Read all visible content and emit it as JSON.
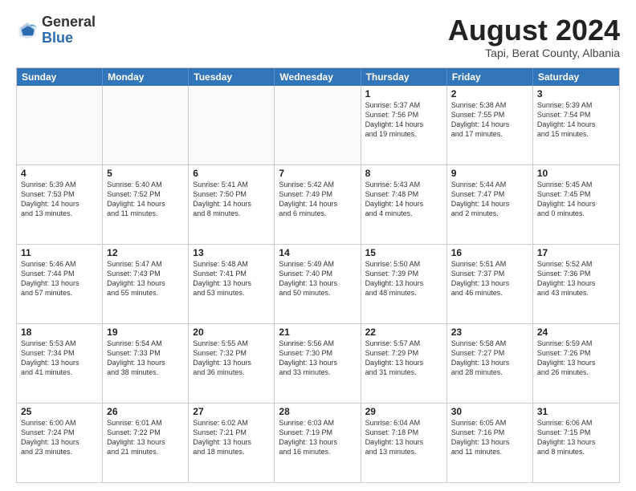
{
  "header": {
    "logo_general": "General",
    "logo_blue": "Blue",
    "month_title": "August 2024",
    "subtitle": "Tapi, Berat County, Albania"
  },
  "days_of_week": [
    "Sunday",
    "Monday",
    "Tuesday",
    "Wednesday",
    "Thursday",
    "Friday",
    "Saturday"
  ],
  "weeks": [
    [
      {
        "day": "",
        "lines": [],
        "empty": true
      },
      {
        "day": "",
        "lines": [],
        "empty": true
      },
      {
        "day": "",
        "lines": [],
        "empty": true
      },
      {
        "day": "",
        "lines": [],
        "empty": true
      },
      {
        "day": "1",
        "lines": [
          "Sunrise: 5:37 AM",
          "Sunset: 7:56 PM",
          "Daylight: 14 hours",
          "and 19 minutes."
        ],
        "empty": false
      },
      {
        "day": "2",
        "lines": [
          "Sunrise: 5:38 AM",
          "Sunset: 7:55 PM",
          "Daylight: 14 hours",
          "and 17 minutes."
        ],
        "empty": false
      },
      {
        "day": "3",
        "lines": [
          "Sunrise: 5:39 AM",
          "Sunset: 7:54 PM",
          "Daylight: 14 hours",
          "and 15 minutes."
        ],
        "empty": false
      }
    ],
    [
      {
        "day": "4",
        "lines": [
          "Sunrise: 5:39 AM",
          "Sunset: 7:53 PM",
          "Daylight: 14 hours",
          "and 13 minutes."
        ],
        "empty": false
      },
      {
        "day": "5",
        "lines": [
          "Sunrise: 5:40 AM",
          "Sunset: 7:52 PM",
          "Daylight: 14 hours",
          "and 11 minutes."
        ],
        "empty": false
      },
      {
        "day": "6",
        "lines": [
          "Sunrise: 5:41 AM",
          "Sunset: 7:50 PM",
          "Daylight: 14 hours",
          "and 8 minutes."
        ],
        "empty": false
      },
      {
        "day": "7",
        "lines": [
          "Sunrise: 5:42 AM",
          "Sunset: 7:49 PM",
          "Daylight: 14 hours",
          "and 6 minutes."
        ],
        "empty": false
      },
      {
        "day": "8",
        "lines": [
          "Sunrise: 5:43 AM",
          "Sunset: 7:48 PM",
          "Daylight: 14 hours",
          "and 4 minutes."
        ],
        "empty": false
      },
      {
        "day": "9",
        "lines": [
          "Sunrise: 5:44 AM",
          "Sunset: 7:47 PM",
          "Daylight: 14 hours",
          "and 2 minutes."
        ],
        "empty": false
      },
      {
        "day": "10",
        "lines": [
          "Sunrise: 5:45 AM",
          "Sunset: 7:45 PM",
          "Daylight: 14 hours",
          "and 0 minutes."
        ],
        "empty": false
      }
    ],
    [
      {
        "day": "11",
        "lines": [
          "Sunrise: 5:46 AM",
          "Sunset: 7:44 PM",
          "Daylight: 13 hours",
          "and 57 minutes."
        ],
        "empty": false
      },
      {
        "day": "12",
        "lines": [
          "Sunrise: 5:47 AM",
          "Sunset: 7:43 PM",
          "Daylight: 13 hours",
          "and 55 minutes."
        ],
        "empty": false
      },
      {
        "day": "13",
        "lines": [
          "Sunrise: 5:48 AM",
          "Sunset: 7:41 PM",
          "Daylight: 13 hours",
          "and 53 minutes."
        ],
        "empty": false
      },
      {
        "day": "14",
        "lines": [
          "Sunrise: 5:49 AM",
          "Sunset: 7:40 PM",
          "Daylight: 13 hours",
          "and 50 minutes."
        ],
        "empty": false
      },
      {
        "day": "15",
        "lines": [
          "Sunrise: 5:50 AM",
          "Sunset: 7:39 PM",
          "Daylight: 13 hours",
          "and 48 minutes."
        ],
        "empty": false
      },
      {
        "day": "16",
        "lines": [
          "Sunrise: 5:51 AM",
          "Sunset: 7:37 PM",
          "Daylight: 13 hours",
          "and 46 minutes."
        ],
        "empty": false
      },
      {
        "day": "17",
        "lines": [
          "Sunrise: 5:52 AM",
          "Sunset: 7:36 PM",
          "Daylight: 13 hours",
          "and 43 minutes."
        ],
        "empty": false
      }
    ],
    [
      {
        "day": "18",
        "lines": [
          "Sunrise: 5:53 AM",
          "Sunset: 7:34 PM",
          "Daylight: 13 hours",
          "and 41 minutes."
        ],
        "empty": false
      },
      {
        "day": "19",
        "lines": [
          "Sunrise: 5:54 AM",
          "Sunset: 7:33 PM",
          "Daylight: 13 hours",
          "and 38 minutes."
        ],
        "empty": false
      },
      {
        "day": "20",
        "lines": [
          "Sunrise: 5:55 AM",
          "Sunset: 7:32 PM",
          "Daylight: 13 hours",
          "and 36 minutes."
        ],
        "empty": false
      },
      {
        "day": "21",
        "lines": [
          "Sunrise: 5:56 AM",
          "Sunset: 7:30 PM",
          "Daylight: 13 hours",
          "and 33 minutes."
        ],
        "empty": false
      },
      {
        "day": "22",
        "lines": [
          "Sunrise: 5:57 AM",
          "Sunset: 7:29 PM",
          "Daylight: 13 hours",
          "and 31 minutes."
        ],
        "empty": false
      },
      {
        "day": "23",
        "lines": [
          "Sunrise: 5:58 AM",
          "Sunset: 7:27 PM",
          "Daylight: 13 hours",
          "and 28 minutes."
        ],
        "empty": false
      },
      {
        "day": "24",
        "lines": [
          "Sunrise: 5:59 AM",
          "Sunset: 7:26 PM",
          "Daylight: 13 hours",
          "and 26 minutes."
        ],
        "empty": false
      }
    ],
    [
      {
        "day": "25",
        "lines": [
          "Sunrise: 6:00 AM",
          "Sunset: 7:24 PM",
          "Daylight: 13 hours",
          "and 23 minutes."
        ],
        "empty": false
      },
      {
        "day": "26",
        "lines": [
          "Sunrise: 6:01 AM",
          "Sunset: 7:22 PM",
          "Daylight: 13 hours",
          "and 21 minutes."
        ],
        "empty": false
      },
      {
        "day": "27",
        "lines": [
          "Sunrise: 6:02 AM",
          "Sunset: 7:21 PM",
          "Daylight: 13 hours",
          "and 18 minutes."
        ],
        "empty": false
      },
      {
        "day": "28",
        "lines": [
          "Sunrise: 6:03 AM",
          "Sunset: 7:19 PM",
          "Daylight: 13 hours",
          "and 16 minutes."
        ],
        "empty": false
      },
      {
        "day": "29",
        "lines": [
          "Sunrise: 6:04 AM",
          "Sunset: 7:18 PM",
          "Daylight: 13 hours",
          "and 13 minutes."
        ],
        "empty": false
      },
      {
        "day": "30",
        "lines": [
          "Sunrise: 6:05 AM",
          "Sunset: 7:16 PM",
          "Daylight: 13 hours",
          "and 11 minutes."
        ],
        "empty": false
      },
      {
        "day": "31",
        "lines": [
          "Sunrise: 6:06 AM",
          "Sunset: 7:15 PM",
          "Daylight: 13 hours",
          "and 8 minutes."
        ],
        "empty": false
      }
    ]
  ]
}
